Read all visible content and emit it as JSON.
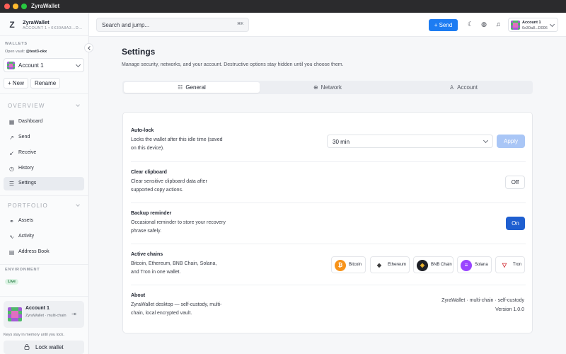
{
  "window": {
    "title": "ZyraWallet"
  },
  "sidebar": {
    "brand_name": "ZyraWallet",
    "brand_sub": "ACCOUNT 1 • 0X30A8A3…D…",
    "wallets_label": "WALLETS",
    "open_vault_label": "Open vault:",
    "open_vault_name": "@test3-okx",
    "selected_account": "Account 1",
    "new_button": "+ New",
    "rename_button": "Rename",
    "overview_label": "OVERVIEW",
    "overview_items": [
      {
        "label": "Dashboard",
        "icon": "grid-icon"
      },
      {
        "label": "Send",
        "icon": "arrow-up-right-icon"
      },
      {
        "label": "Receive",
        "icon": "arrow-down-left-icon"
      },
      {
        "label": "History",
        "icon": "clock-icon"
      },
      {
        "label": "Settings",
        "icon": "sliders-icon",
        "active": true
      }
    ],
    "portfolio_label": "PORTFOLIO",
    "portfolio_items": [
      {
        "label": "Assets",
        "icon": "link-icon"
      },
      {
        "label": "Activity",
        "icon": "activity-icon"
      },
      {
        "label": "Address Book",
        "icon": "book-icon"
      }
    ],
    "environment_label": "ENVIRONMENT",
    "environment_badge": "Live",
    "account_card_name": "Account 1",
    "account_card_desc": "ZyraWallet · multi-chain",
    "keys_note": "Keys stay in memory until you lock.",
    "lock_button": "Lock wallet"
  },
  "topbar": {
    "search_placeholder": "Search and jump...",
    "search_shortcut": "⌘K",
    "send_button": "+ Send",
    "account_name": "Account 1",
    "account_address": "0x30a8...D006"
  },
  "main": {
    "title": "Settings",
    "subtitle": "Manage security, networks, and your account. Destructive options stay hidden until you choose them.",
    "tabs": [
      {
        "label": "General",
        "icon": "sliders-icon",
        "active": true
      },
      {
        "label": "Network",
        "icon": "globe-icon"
      },
      {
        "label": "Account",
        "icon": "user-icon"
      }
    ],
    "autolock": {
      "title": "Auto-lock",
      "desc": "Locks the wallet after this idle time (saved on this device).",
      "value": "30 min",
      "apply": "Apply"
    },
    "clipboard": {
      "title": "Clear clipboard",
      "desc": "Clear sensitive clipboard data after supported copy actions.",
      "state": "Off"
    },
    "backup": {
      "title": "Backup reminder",
      "desc": "Occasional reminder to store your recovery phrase safely.",
      "state": "On"
    },
    "chains": {
      "title": "Active chains",
      "desc": "Bitcoin, Ethereum, BNB Chain, Solana, and Tron in one wallet.",
      "items": [
        {
          "name": "Bitcoin",
          "icon": "bitcoin-icon",
          "color": "#f7931a",
          "glyph": "₿"
        },
        {
          "name": "Ethereum",
          "icon": "ethereum-icon",
          "color": "#ffffff",
          "glyph": "◆"
        },
        {
          "name": "BNB Chain",
          "icon": "bnb-icon",
          "color": "#1e2026",
          "glyph": "◈"
        },
        {
          "name": "Solana",
          "icon": "solana-icon",
          "color": "#9945ff",
          "glyph": "≡"
        },
        {
          "name": "Tron",
          "icon": "tron-icon",
          "color": "#ffffff",
          "glyph": "▽"
        }
      ]
    },
    "about": {
      "title": "About",
      "desc": "ZyraWallet desktop — self-custody, multi-chain, local encrypted vault.",
      "line1": "ZyraWallet · multi-chain · self-custody",
      "line2": "Version 1.0.0"
    }
  },
  "colors": {
    "accent": "#1d7cf2",
    "toggle_on": "#1f5fd0",
    "apply_disabled": "#a9c6f6",
    "live_badge": "#dcf3e4"
  }
}
